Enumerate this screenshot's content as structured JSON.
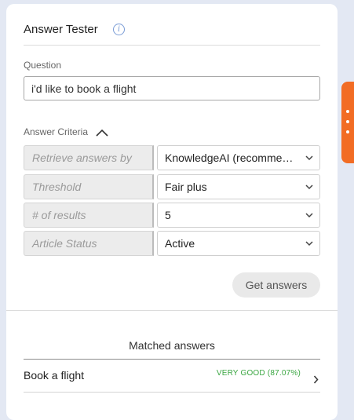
{
  "header": {
    "title": "Answer Tester",
    "info_icon": "info-icon"
  },
  "question": {
    "label": "Question",
    "value": "i'd like to book a flight"
  },
  "criteria": {
    "label": "Answer Criteria",
    "expanded": true,
    "rows": [
      {
        "key": "Retrieve answers by",
        "value": "KnowledgeAI (recommended)"
      },
      {
        "key": "Threshold",
        "value": "Fair plus"
      },
      {
        "key": "# of results",
        "value": "5"
      },
      {
        "key": "Article Status",
        "value": "Active"
      }
    ]
  },
  "actions": {
    "get_answers_label": "Get answers"
  },
  "matched": {
    "title": "Matched answers",
    "results": [
      {
        "name": "Book a flight",
        "score": "VERY GOOD (87.07%)"
      }
    ]
  },
  "colors": {
    "accent_tab": "#f26c24",
    "score_good": "#3aa641",
    "background": "#e3e8f3"
  }
}
